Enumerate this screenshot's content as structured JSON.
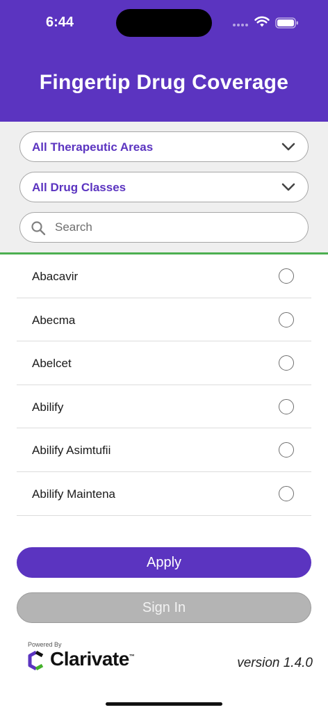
{
  "status_bar": {
    "time": "6:44",
    "wifi_icon": "wifi-icon",
    "battery_icon": "battery-icon"
  },
  "header": {
    "title": "Fingertip Drug Coverage",
    "background_color": "#5b34c0"
  },
  "filters": {
    "therapeutic_area": {
      "selected": "All Therapeutic Areas",
      "icon": "chevron-down-icon"
    },
    "drug_class": {
      "selected": "All Drug Classes",
      "icon": "chevron-down-icon"
    },
    "search": {
      "placeholder": "Search",
      "value": "",
      "icon": "search-icon"
    },
    "divider_color": "#4caf50"
  },
  "drug_list": {
    "items": [
      {
        "name": "Abacavir",
        "selected": false
      },
      {
        "name": "Abecma",
        "selected": false
      },
      {
        "name": "Abelcet",
        "selected": false
      },
      {
        "name": "Abilify",
        "selected": false
      },
      {
        "name": "Abilify Asimtufii",
        "selected": false
      },
      {
        "name": "Abilify Maintena",
        "selected": false
      }
    ]
  },
  "actions": {
    "apply_label": "Apply",
    "sign_in_label": "Sign In"
  },
  "footer": {
    "powered_by": "Powered By",
    "brand": "Clarivate",
    "trademark": "™",
    "version": "version 1.4.0"
  }
}
